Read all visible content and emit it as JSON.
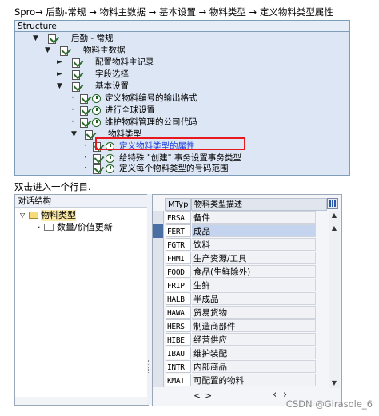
{
  "breadcrumb": "Spro→ 后勤-常规 → 物料主数据 → 基本设置 → 物料类型 → 定义物料类型属性",
  "tree": {
    "header": "Structure",
    "nodes": [
      {
        "label": "后勤 - 常规"
      },
      {
        "label": "物料主数据"
      },
      {
        "label": "配置物料主记录"
      },
      {
        "label": "字段选择"
      },
      {
        "label": "基本设置"
      },
      {
        "label": "定义物料编号的输出格式"
      },
      {
        "label": "进行全球设置"
      },
      {
        "label": "维护物料管理的公司代码"
      },
      {
        "label": "物料类型"
      },
      {
        "label": "定义物料类型的属性"
      },
      {
        "label": "给特殊 \"创建\" 事务设置事务类型"
      },
      {
        "label": "定义每个物料类型的号码范围"
      }
    ]
  },
  "instruction": "双击进入一个行目.",
  "dialog_structure": {
    "header": "对话结构",
    "items": [
      {
        "label": "物料类型"
      },
      {
        "label": "数量/价值更新"
      }
    ]
  },
  "grid": {
    "col_mtyp": "MTyp",
    "col_desc": "物料类型描述",
    "rows": [
      {
        "code": "ERSA",
        "desc": "备件"
      },
      {
        "code": "FERT",
        "desc": "成品"
      },
      {
        "code": "FGTR",
        "desc": "饮料"
      },
      {
        "code": "FHMI",
        "desc": "生产资源/工具"
      },
      {
        "code": "FOOD",
        "desc": "食品(生鲜除外)"
      },
      {
        "code": "FRIP",
        "desc": "生鲜"
      },
      {
        "code": "HALB",
        "desc": "半成品"
      },
      {
        "code": "HAWA",
        "desc": "贸易货物"
      },
      {
        "code": "HERS",
        "desc": "制造商部件"
      },
      {
        "code": "HIBE",
        "desc": "经营供应"
      },
      {
        "code": "IBAU",
        "desc": "维护装配"
      },
      {
        "code": "INTR",
        "desc": "内部商品"
      },
      {
        "code": "KMAT",
        "desc": "可配置的物料"
      }
    ]
  },
  "watermark": "CSDN @Girasole_6"
}
